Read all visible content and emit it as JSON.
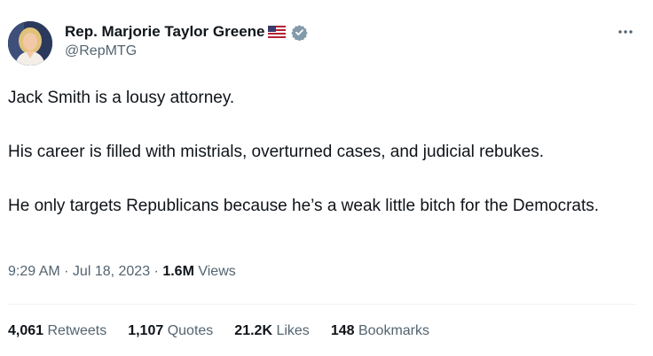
{
  "author": {
    "display_name": "Rep. Marjorie Taylor Greene",
    "handle": "@RepMTG",
    "flag_icon": "us-flag-icon",
    "verified_icon": "verified-badge-icon",
    "verified_color": "#829aab"
  },
  "tweet": {
    "paragraphs": [
      "Jack Smith is a lousy attorney.",
      "His career is filled with mistrials, overturned cases, and judicial rebukes.",
      "He only targets Republicans because he’s a weak little bitch for the Democrats."
    ]
  },
  "meta": {
    "time": "9:29 AM",
    "separator": " · ",
    "date": "Jul 18, 2023",
    "views_count": "1.6M",
    "views_label": "Views"
  },
  "stats": [
    {
      "count": "4,061",
      "label": "Retweets"
    },
    {
      "count": "1,107",
      "label": "Quotes"
    },
    {
      "count": "21.2K",
      "label": "Likes"
    },
    {
      "count": "148",
      "label": "Bookmarks"
    }
  ],
  "colors": {
    "text": "#0f1419",
    "secondary": "#536471",
    "divider": "#eff3f4"
  }
}
